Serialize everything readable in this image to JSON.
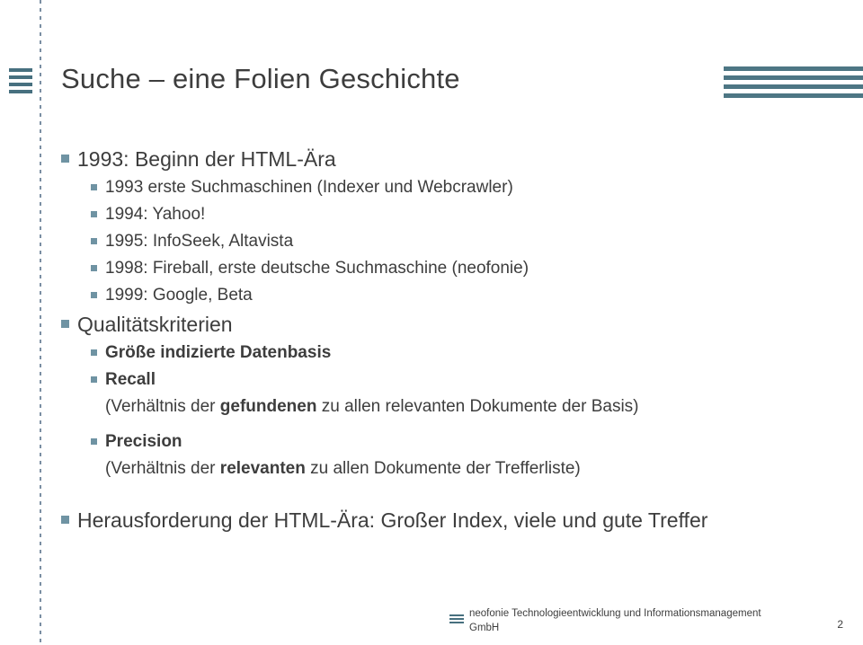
{
  "slide": {
    "title": "Suche – eine Folien Geschichte",
    "page_number": "2",
    "accent_color": "#6f93a3",
    "bar_color": "#4d7684",
    "text_color": "#3d3d3d",
    "logo_icon": "stacked-bars-logo-icon",
    "bullets": [
      {
        "level": 1,
        "text": "1993: Beginn der HTML-Ära"
      },
      {
        "level": 2,
        "text": "1993 erste Suchmaschinen (Indexer und Webcrawler)"
      },
      {
        "level": 2,
        "text": "1994: Yahoo!"
      },
      {
        "level": 2,
        "text": "1995: InfoSeek, Altavista"
      },
      {
        "level": 2,
        "text": "1998: Fireball, erste deutsche Suchmaschine (neofonie)"
      },
      {
        "level": 2,
        "text": "1999: Google, Beta"
      },
      {
        "level": 1,
        "text": "Qualitätskriterien"
      },
      {
        "level": 2,
        "text": "Größe indizierte Datenbasis",
        "bold": true
      },
      {
        "level": 2,
        "text": "Recall",
        "bold": true
      },
      {
        "level": 0,
        "text_parts": [
          {
            "t": "(Verhältnis der ",
            "bold": false
          },
          {
            "t": "gefundenen",
            "bold": true
          },
          {
            "t": " zu allen relevanten Dokumente der Basis)",
            "bold": false
          }
        ]
      },
      {
        "level": 2,
        "text": "Precision",
        "bold": true
      },
      {
        "level": 0,
        "text_parts": [
          {
            "t": "(Verhältnis der ",
            "bold": false
          },
          {
            "t": "relevanten",
            "bold": true
          },
          {
            "t": " zu allen Dokumente der Trefferliste)",
            "bold": false
          }
        ]
      },
      {
        "level": 1,
        "text": "Herausforderung der HTML-Ära: Großer Index, viele und gute Treffer"
      }
    ],
    "footer": {
      "line1": "neofonie Technologieentwicklung und Informationsmanagement",
      "line2": "GmbH"
    }
  }
}
